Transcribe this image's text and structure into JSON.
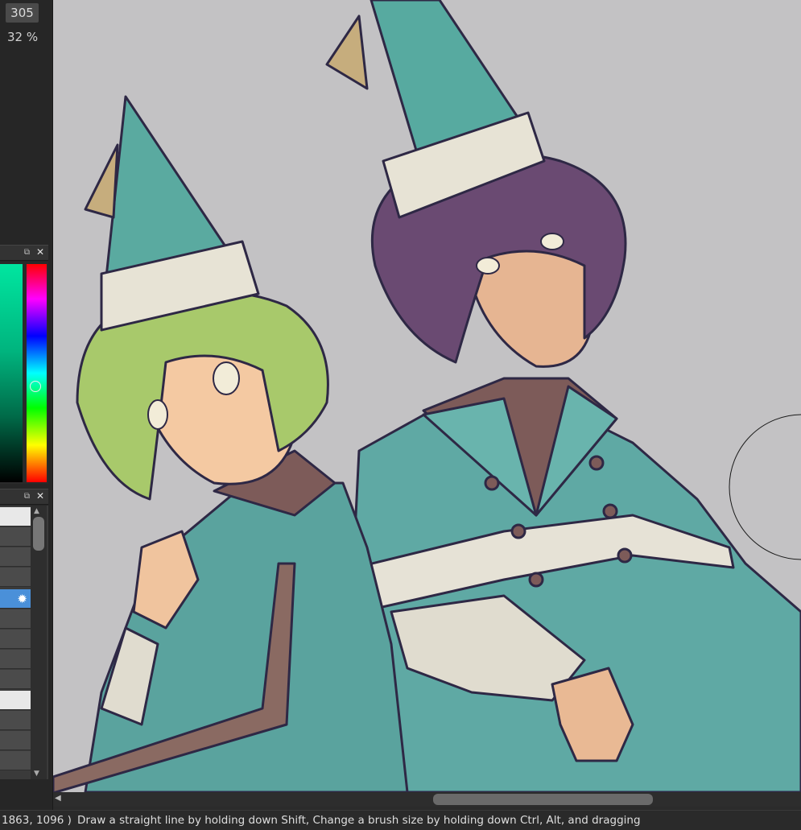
{
  "toolbar": {
    "brush_size": "305",
    "zoom": "32 %"
  },
  "status": {
    "coords": "1863, 1096 )",
    "hint": "Draw a straight line by holding down Shift, Change a brush size by holding down Ctrl, Alt, and dragging"
  },
  "colors": {
    "canvas_bg": "#c3c2c4",
    "robe": "#5fa9a4",
    "hat": "#5aaaa0",
    "selected_layer": "#4a90d9"
  },
  "icons": {
    "panel_popout": "popout-icon",
    "panel_close": "close-icon",
    "layer_settings": "gear-icon"
  }
}
